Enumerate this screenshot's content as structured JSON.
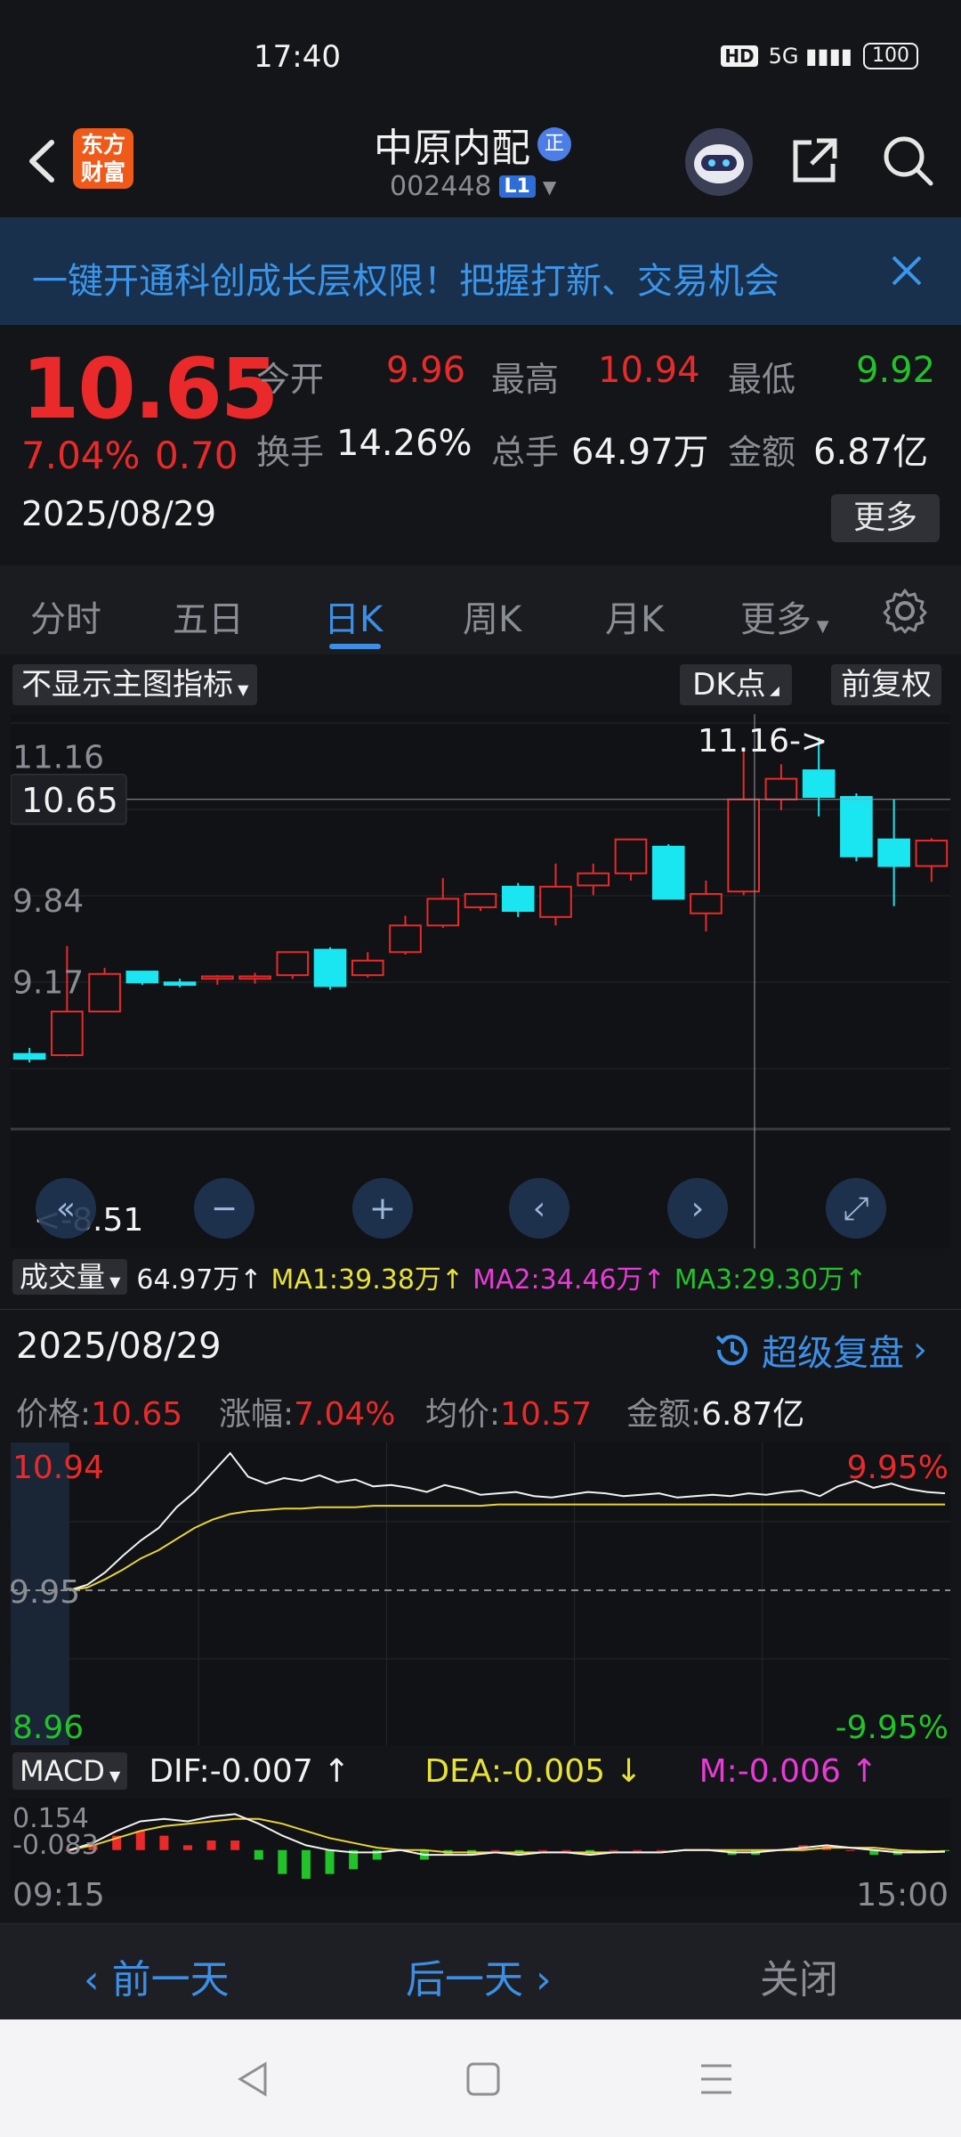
{
  "status_bar": {
    "time": "17:40",
    "hd": "HD",
    "network": "5G",
    "battery": "100"
  },
  "header": {
    "logo_text_1": "东方",
    "logo_text_2": "财富",
    "stock_name": "中原内配",
    "badge": "正",
    "code": "002448",
    "level": "L1"
  },
  "banner": {
    "text": "一键开通科创成长层权限！把握打新、交易机会"
  },
  "quote": {
    "price": "10.65",
    "change_pct": "7.04%",
    "change_abs": "0.70",
    "date": "2025/08/29",
    "open_label": "今开",
    "open": "9.96",
    "high_label": "最高",
    "high": "10.94",
    "low_label": "最低",
    "low": "9.92",
    "turnover_label": "换手",
    "turnover": "14.26%",
    "volume_label": "总手",
    "volume": "64.97万",
    "amount_label": "金额",
    "amount": "6.87亿",
    "more_label": "更多"
  },
  "tabs": [
    {
      "label": "分时"
    },
    {
      "label": "五日"
    },
    {
      "label": "日K"
    },
    {
      "label": "周K"
    },
    {
      "label": "月K"
    },
    {
      "label": "更多"
    }
  ],
  "chart_controls": {
    "indicator": "不显示主图指标",
    "dk": "DK点",
    "adjust": "前复权"
  },
  "chart_data": [
    {
      "type": "candlestick",
      "y_ticks": [
        "11.16",
        "9.84",
        "9.17"
      ],
      "current_price_label": "10.65",
      "max_label": "11.16->",
      "min_label": "<-8.51",
      "ylim": [
        8.43,
        11.28
      ],
      "candles": [
        {
          "o": 8.55,
          "h": 8.6,
          "l": 8.48,
          "c": 8.51
        },
        {
          "o": 8.54,
          "h": 9.44,
          "l": 8.53,
          "c": 8.9
        },
        {
          "o": 8.9,
          "h": 9.26,
          "l": 9.09,
          "c": 9.21
        },
        {
          "o": 9.23,
          "h": 9.22,
          "l": 9.12,
          "c": 9.14
        },
        {
          "o": 9.14,
          "h": 9.17,
          "l": 9.1,
          "c": 9.12
        },
        {
          "o": 9.17,
          "h": 9.2,
          "l": 9.12,
          "c": 9.19
        },
        {
          "o": 9.17,
          "h": 9.22,
          "l": 9.13,
          "c": 9.19
        },
        {
          "o": 9.2,
          "h": 9.39,
          "l": 9.17,
          "c": 9.39
        },
        {
          "o": 9.41,
          "h": 9.43,
          "l": 9.08,
          "c": 9.11
        },
        {
          "o": 9.2,
          "h": 9.39,
          "l": 9.18,
          "c": 9.32
        },
        {
          "o": 9.39,
          "h": 9.69,
          "l": 9.37,
          "c": 9.61
        },
        {
          "o": 9.61,
          "h": 10.0,
          "l": 9.59,
          "c": 9.83
        },
        {
          "o": 9.76,
          "h": 9.87,
          "l": 9.73,
          "c": 9.87
        },
        {
          "o": 9.93,
          "h": 9.96,
          "l": 9.68,
          "c": 9.73
        },
        {
          "o": 9.68,
          "h": 10.12,
          "l": 9.61,
          "c": 9.93
        },
        {
          "o": 9.94,
          "h": 10.12,
          "l": 9.86,
          "c": 10.04
        },
        {
          "o": 10.04,
          "h": 10.31,
          "l": 9.98,
          "c": 10.32
        },
        {
          "o": 10.26,
          "h": 10.28,
          "l": 9.83,
          "c": 9.83
        },
        {
          "o": 9.71,
          "h": 9.98,
          "l": 9.56,
          "c": 9.87
        },
        {
          "o": 9.89,
          "h": 11.05,
          "l": 9.86,
          "c": 10.65
        },
        {
          "o": 10.65,
          "h": 10.94,
          "l": 10.56,
          "c": 10.82
        },
        {
          "o": 10.89,
          "h": 11.16,
          "l": 10.51,
          "c": 10.67
        },
        {
          "o": 10.67,
          "h": 10.7,
          "l": 10.14,
          "c": 10.18
        },
        {
          "o": 10.32,
          "h": 10.65,
          "l": 9.77,
          "c": 10.1
        },
        {
          "o": 10.1,
          "h": 10.33,
          "l": 9.97,
          "c": 10.31
        }
      ]
    },
    {
      "type": "line",
      "name": "intraday",
      "y_ticks_left": [
        "10.94",
        "9.95",
        "8.96"
      ],
      "y_ticks_right": [
        "9.95%",
        "-9.95%"
      ],
      "ylim": [
        8.96,
        10.94
      ],
      "price": [
        9.95,
        9.99,
        10.08,
        10.2,
        10.31,
        10.4,
        10.55,
        10.66,
        10.8,
        10.94,
        10.77,
        10.72,
        10.76,
        10.74,
        10.78,
        10.73,
        10.75,
        10.7,
        10.71,
        10.69,
        10.66,
        10.71,
        10.68,
        10.64,
        10.65,
        10.66,
        10.63,
        10.62,
        10.64,
        10.66,
        10.65,
        10.63,
        10.64,
        10.65,
        10.62,
        10.63,
        10.64,
        10.63,
        10.65,
        10.64,
        10.66,
        10.67,
        10.63,
        10.7,
        10.74,
        10.69,
        10.72,
        10.68,
        10.66,
        10.65
      ],
      "avg": [
        9.95,
        9.97,
        10.03,
        10.1,
        10.18,
        10.24,
        10.32,
        10.4,
        10.46,
        10.5,
        10.52,
        10.53,
        10.54,
        10.54,
        10.55,
        10.55,
        10.55,
        10.56,
        10.56,
        10.56,
        10.56,
        10.56,
        10.56,
        10.56,
        10.57,
        10.57,
        10.57,
        10.57,
        10.57,
        10.57,
        10.57,
        10.57,
        10.57,
        10.57,
        10.57,
        10.57,
        10.57,
        10.57,
        10.57,
        10.57,
        10.57,
        10.57,
        10.57,
        10.57,
        10.57,
        10.57,
        10.57,
        10.57,
        10.57,
        10.57
      ]
    },
    {
      "type": "line",
      "name": "macd",
      "y_ticks": [
        "0.154",
        "-0.083"
      ],
      "ylim": [
        -0.12,
        0.2
      ],
      "dif": [
        0.0,
        0.03,
        0.08,
        0.12,
        0.13,
        0.12,
        0.14,
        0.15,
        0.11,
        0.06,
        0.02,
        0.0,
        -0.01,
        -0.01,
        0.0,
        -0.02,
        -0.02,
        -0.02,
        -0.01,
        -0.02,
        -0.01,
        -0.01,
        -0.02,
        -0.01,
        -0.01,
        -0.01,
        0.0,
        0.0,
        -0.01,
        -0.01,
        0.0,
        0.01,
        0.02,
        0.01,
        0.0,
        -0.01,
        -0.01,
        -0.007
      ],
      "dea": [
        0.0,
        0.02,
        0.05,
        0.08,
        0.1,
        0.11,
        0.12,
        0.13,
        0.13,
        0.11,
        0.08,
        0.05,
        0.03,
        0.01,
        0.0,
        0.0,
        -0.01,
        -0.01,
        -0.01,
        -0.01,
        -0.01,
        -0.01,
        -0.01,
        -0.01,
        -0.01,
        -0.01,
        0.0,
        0.0,
        0.0,
        0.0,
        0.0,
        0.0,
        0.01,
        0.01,
        0.01,
        0.0,
        -0.005,
        -0.005
      ],
      "x_start": "09:15",
      "x_end": "15:00"
    }
  ],
  "volume_row": {
    "label": "成交量",
    "vol": "64.97万",
    "ma1": "MA1:39.38万",
    "ma2": "MA2:34.46万",
    "ma3": "MA3:29.30万"
  },
  "intraday_header": {
    "date": "2025/08/29",
    "super_replay": "超级复盘",
    "price_label": "价格:",
    "price": "10.65",
    "change_label": "涨幅:",
    "change": "7.04%",
    "avg_label": "均价:",
    "avg": "10.57",
    "amount_label": "金额:",
    "amount": "6.87亿"
  },
  "macd_row": {
    "label": "MACD",
    "dif": "DIF:-0.007",
    "dea": "DEA:-0.005",
    "m": "M:-0.006"
  },
  "actions": {
    "prev": "前一天",
    "next": "后一天",
    "close": "关闭"
  },
  "colors": {
    "up": "#ea2a2a",
    "down": "#22c22b",
    "cyan": "#19e6f0",
    "accent": "#3d8fe6"
  }
}
